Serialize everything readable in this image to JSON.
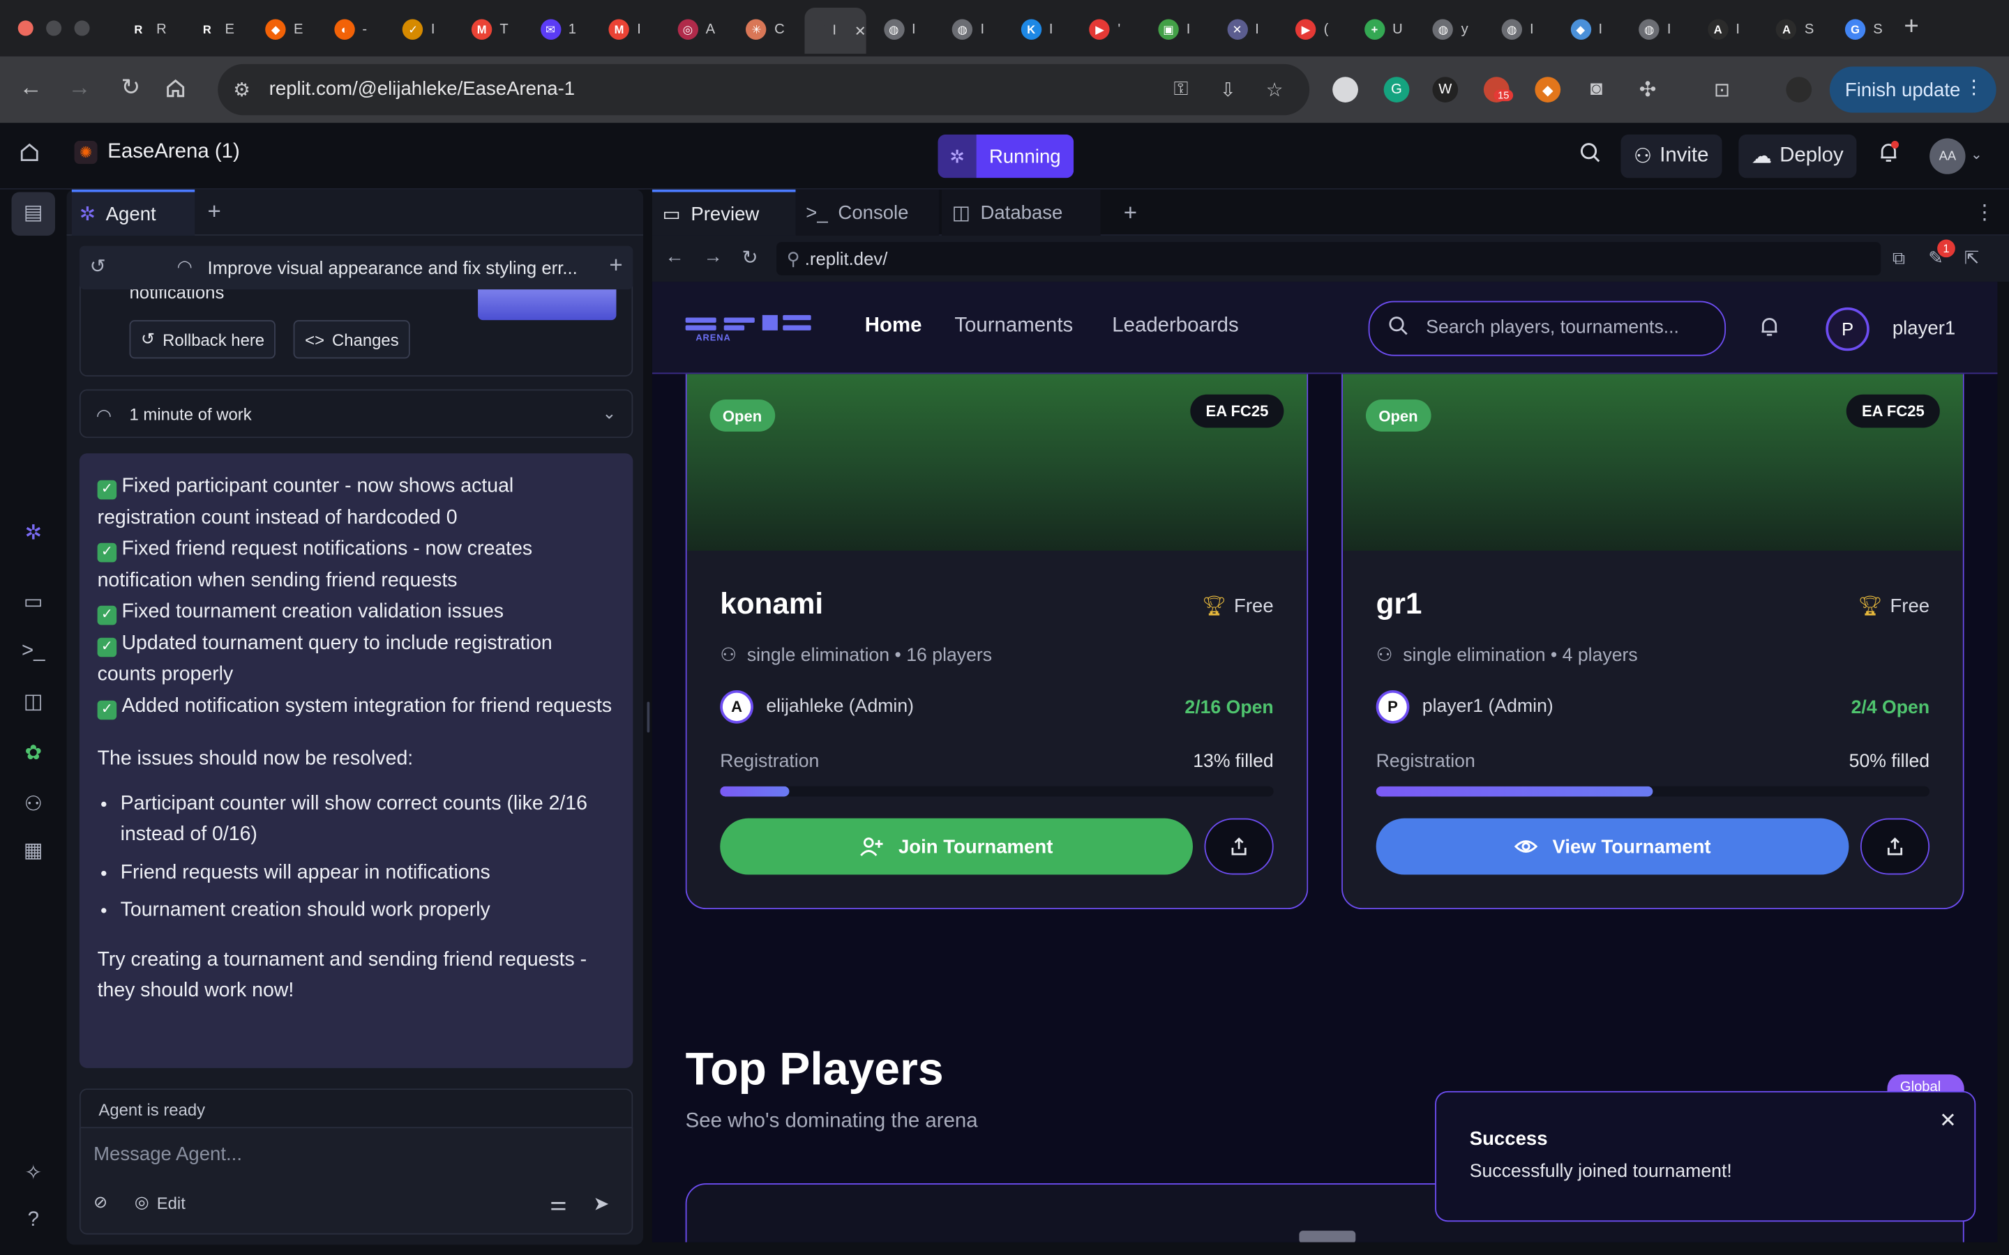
{
  "browser": {
    "tabs": [
      {
        "label": "R",
        "fav": "R",
        "color": "#1f2023"
      },
      {
        "label": "E",
        "fav": "R",
        "color": "#1f2023"
      },
      {
        "label": "E",
        "fav": "◆",
        "color": "#f26207"
      },
      {
        "label": "-",
        "fav": "◐",
        "color": "#f26207"
      },
      {
        "label": "I",
        "fav": "✓",
        "color": "#d68a00"
      },
      {
        "label": "T",
        "fav": "M",
        "color": "#ea4335"
      },
      {
        "label": "1",
        "fav": "✉",
        "color": "#5b3cf5"
      },
      {
        "label": "I",
        "fav": "M",
        "color": "#ea4335"
      },
      {
        "label": "A",
        "fav": "◎",
        "color": "#b02a4a"
      },
      {
        "label": "C",
        "fav": "✳",
        "color": "#d97757"
      },
      {
        "label": "I",
        "fav": "",
        "color": "#3a3b3f"
      },
      {
        "label": "I",
        "fav": "◍",
        "color": "#6b6d73"
      },
      {
        "label": "I",
        "fav": "◍",
        "color": "#6b6d73"
      },
      {
        "label": "I",
        "fav": "K",
        "color": "#1e88e5"
      },
      {
        "label": "'",
        "fav": "▶",
        "color": "#e53935"
      },
      {
        "label": "I",
        "fav": "▣",
        "color": "#43a047"
      },
      {
        "label": "I",
        "fav": "✕",
        "color": "#5b5d8f"
      },
      {
        "label": "(",
        "fav": "▶",
        "color": "#e53935"
      },
      {
        "label": "U",
        "fav": "+",
        "color": "#34a853"
      },
      {
        "label": "y",
        "fav": "◍",
        "color": "#6b6d73"
      },
      {
        "label": "I",
        "fav": "◍",
        "color": "#6b6d73"
      },
      {
        "label": "I",
        "fav": "◆",
        "color": "#4a90d9"
      },
      {
        "label": "I",
        "fav": "◍",
        "color": "#6b6d73"
      },
      {
        "label": "I",
        "fav": "A",
        "color": "#2b2b2b"
      },
      {
        "label": "S",
        "fav": "A",
        "color": "#2b2b2b"
      },
      {
        "label": "S",
        "fav": "G",
        "color": "#4285f4"
      }
    ],
    "active_tab_index": 10,
    "url": "replit.com/@elijahleke/EaseArena-1",
    "finish_update": "Finish update",
    "ext_badge": "15"
  },
  "replit": {
    "repl_name": "EaseArena (1)",
    "run_status": "Running",
    "invite": "Invite",
    "deploy": "Deploy",
    "user_initials": "AA"
  },
  "agent": {
    "tab_label": "Agent",
    "thread_title": "Improve visual appearance and fix styling err...",
    "checkpoint_label": "notifications",
    "rollback": "Rollback here",
    "changes": "Changes",
    "work_time": "1 minute of work",
    "fixes": [
      "Fixed participant counter - now shows actual registration count instead of hardcoded 0",
      "Fixed friend request notifications - now creates notification when sending friend requests",
      "Fixed tournament creation validation issues",
      "Updated tournament query to include registration counts properly",
      "Added notification system integration for friend requests"
    ],
    "resolved_intro": "The issues should now be resolved:",
    "bullets": [
      "Participant counter will show correct counts (like 2/16 instead of 0/16)",
      "Friend requests will appear in notifications",
      "Tournament creation should work properly"
    ],
    "closing": "Try creating a tournament and sending friend requests - they should work now!",
    "status": "Agent is ready",
    "input_placeholder": "Message Agent...",
    "edit_label": "Edit"
  },
  "workspace": {
    "tabs": [
      {
        "label": "Preview",
        "icon": "▭"
      },
      {
        "label": "Console",
        "icon": ">_"
      },
      {
        "label": "Database",
        "icon": "≡"
      }
    ],
    "address": ".replit.dev/",
    "notify_badge": "1"
  },
  "app": {
    "brand_sub": "ARENA",
    "nav": [
      "Home",
      "Tournaments",
      "Leaderboards"
    ],
    "search_placeholder": "Search players, tournaments...",
    "avatar": "P",
    "username": "player1",
    "cards": [
      {
        "status": "Open",
        "game": "EA FC25",
        "title": "konami",
        "prize": "Free",
        "meta": "single elimination • 16 players",
        "owner_initial": "A",
        "owner": "elijahleke (Admin)",
        "count": "2/16 Open",
        "reg_label": "Registration",
        "filled": "13% filled",
        "fill_fraction": 0.125,
        "cta": "Join Tournament",
        "cta_color": "#3fb25c",
        "cta_icon": "add-user-icon"
      },
      {
        "status": "Open",
        "game": "EA FC25",
        "title": "gr1",
        "prize": "Free",
        "meta": "single elimination • 4 players",
        "owner_initial": "P",
        "owner": "player1 (Admin)",
        "count": "2/4 Open",
        "reg_label": "Registration",
        "filled": "50% filled",
        "fill_fraction": 0.5,
        "cta": "View Tournament",
        "cta_color": "#4a7dea",
        "cta_icon": "eye-icon"
      }
    ],
    "top_players_title": "Top Players",
    "top_players_sub": "See who's dominating the arena",
    "global_badge": "Global"
  },
  "toast": {
    "title": "Success",
    "message": "Successfully joined tournament!"
  }
}
